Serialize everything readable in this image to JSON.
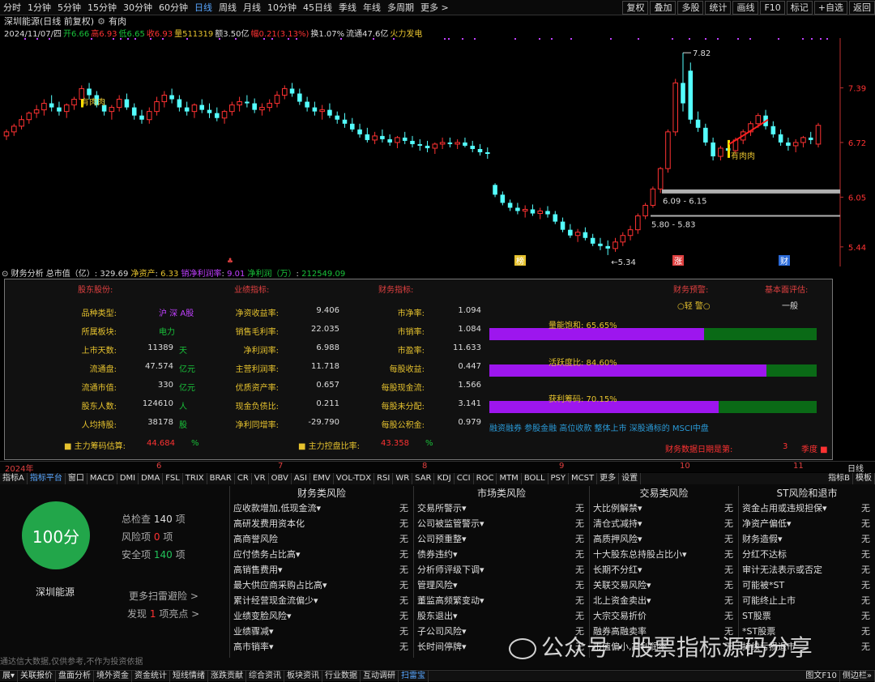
{
  "toolbar": {
    "periods": [
      "分时",
      "1分钟",
      "5分钟",
      "15分钟",
      "30分钟",
      "60分钟",
      "日线",
      "周线",
      "月线",
      "10分钟",
      "45日线",
      "季线",
      "年线",
      "多周期",
      "更多 >"
    ],
    "active_period": "日线",
    "right_buttons": [
      "复权",
      "叠加",
      "多股",
      "统计",
      "画线",
      "F10",
      "标记",
      "+自选",
      "返回"
    ]
  },
  "title": {
    "name": "深圳能源(日线 前复权)",
    "indicator": "有肉"
  },
  "quote": {
    "date": "2024/11/07/四",
    "open": "开6.66",
    "high": "高6.93",
    "low": "低6.65",
    "close": "收6.93",
    "volume": "量511319",
    "amount": "额3.50亿",
    "change": "幅0.21(3.13%)",
    "turnover": "换1.07%",
    "float": "流通47.6亿",
    "sector": "火力发电"
  },
  "chart": {
    "price_labels": [
      "7.39",
      "6.72",
      "6.05",
      "5.44"
    ],
    "annotations": {
      "high": "7.82",
      "low": "5.34",
      "range1": "6.09 - 6.15",
      "range2": "5.80 - 5.83",
      "youroulabel": "有肉肉",
      "markers": [
        "榜",
        "涨",
        "财"
      ]
    },
    "colors": {
      "up": "#ff3232",
      "down": "#54ffff",
      "text": "#e6c22e"
    }
  },
  "candles": [
    [
      6.8,
      6.88,
      6.75,
      6.85
    ],
    [
      6.85,
      6.95,
      6.8,
      6.92
    ],
    [
      6.92,
      7.05,
      6.88,
      7.0
    ],
    [
      7.0,
      7.1,
      6.95,
      7.08
    ],
    [
      7.08,
      7.18,
      7.02,
      7.12
    ],
    [
      7.12,
      7.25,
      7.05,
      7.2
    ],
    [
      7.2,
      7.3,
      7.1,
      7.15
    ],
    [
      7.15,
      7.22,
      7.05,
      7.1
    ],
    [
      7.1,
      7.2,
      7.02,
      7.18
    ],
    [
      7.18,
      7.28,
      7.12,
      7.25
    ],
    [
      7.25,
      7.42,
      7.2,
      7.38
    ],
    [
      7.38,
      7.45,
      7.25,
      7.3
    ],
    [
      7.3,
      7.35,
      7.15,
      7.18
    ],
    [
      7.18,
      7.25,
      7.05,
      7.1
    ],
    [
      7.1,
      7.18,
      7.0,
      7.15
    ],
    [
      7.15,
      7.3,
      7.1,
      7.25
    ],
    [
      7.25,
      7.32,
      7.12,
      7.15
    ],
    [
      7.15,
      7.2,
      7.0,
      7.05
    ],
    [
      7.05,
      7.12,
      6.95,
      7.0
    ],
    [
      7.0,
      7.15,
      6.95,
      7.1
    ],
    [
      7.1,
      7.28,
      7.05,
      7.22
    ],
    [
      7.22,
      7.35,
      7.15,
      7.3
    ],
    [
      7.3,
      7.38,
      7.2,
      7.25
    ],
    [
      7.25,
      7.3,
      7.1,
      7.15
    ],
    [
      7.15,
      7.22,
      7.05,
      7.1
    ],
    [
      7.1,
      7.2,
      7.02,
      7.18
    ],
    [
      7.18,
      7.25,
      7.08,
      7.12
    ],
    [
      7.12,
      7.2,
      7.02,
      7.08
    ],
    [
      7.08,
      7.15,
      6.98,
      7.02
    ],
    [
      7.02,
      7.12,
      6.95,
      7.1
    ],
    [
      7.1,
      7.22,
      7.05,
      7.18
    ],
    [
      7.18,
      7.28,
      7.1,
      7.22
    ],
    [
      7.22,
      7.3,
      7.15,
      7.2
    ],
    [
      7.2,
      7.26,
      7.08,
      7.12
    ],
    [
      7.12,
      7.2,
      7.05,
      7.15
    ],
    [
      7.15,
      7.25,
      7.1,
      7.2
    ],
    [
      7.2,
      7.35,
      7.15,
      7.3
    ],
    [
      7.3,
      7.42,
      7.25,
      7.38
    ],
    [
      7.38,
      7.45,
      7.28,
      7.32
    ],
    [
      7.32,
      7.38,
      7.18,
      7.22
    ],
    [
      7.22,
      7.28,
      7.1,
      7.15
    ],
    [
      7.15,
      7.22,
      7.05,
      7.1
    ],
    [
      7.1,
      7.18,
      7.0,
      7.12
    ],
    [
      7.12,
      7.2,
      7.02,
      7.05
    ],
    [
      7.05,
      7.1,
      6.95,
      7.0
    ],
    [
      7.0,
      7.08,
      6.9,
      6.95
    ],
    [
      6.95,
      7.02,
      6.85,
      6.88
    ],
    [
      6.88,
      6.95,
      6.78,
      6.82
    ],
    [
      6.82,
      6.9,
      6.72,
      6.75
    ],
    [
      6.75,
      6.85,
      6.7,
      6.8
    ],
    [
      6.8,
      6.88,
      6.72,
      6.76
    ],
    [
      6.76,
      6.82,
      6.68,
      6.72
    ],
    [
      6.72,
      6.8,
      6.65,
      6.78
    ],
    [
      6.78,
      6.85,
      6.7,
      6.74
    ],
    [
      6.74,
      6.8,
      6.66,
      6.7
    ],
    [
      6.7,
      6.76,
      6.62,
      6.68
    ],
    [
      6.68,
      6.74,
      6.6,
      6.65
    ],
    [
      6.65,
      6.72,
      6.58,
      6.7
    ],
    [
      6.7,
      6.78,
      6.64,
      6.72
    ],
    [
      6.72,
      6.78,
      6.66,
      6.7
    ],
    [
      6.7,
      6.76,
      6.64,
      6.72
    ],
    [
      6.72,
      6.78,
      6.66,
      6.68
    ],
    [
      6.68,
      6.74,
      6.6,
      6.64
    ],
    [
      6.64,
      6.7,
      6.56,
      6.6
    ],
    [
      6.6,
      6.66,
      6.52,
      6.58
    ],
    [
      6.2,
      6.22,
      6.05,
      6.08
    ],
    [
      6.08,
      6.12,
      5.95,
      5.98
    ],
    [
      5.98,
      6.02,
      5.88,
      5.92
    ],
    [
      5.92,
      5.98,
      5.84,
      5.88
    ],
    [
      5.88,
      5.95,
      5.8,
      5.9
    ],
    [
      5.9,
      5.96,
      5.82,
      5.85
    ],
    [
      5.85,
      5.92,
      5.78,
      5.88
    ],
    [
      5.88,
      5.94,
      5.8,
      5.84
    ],
    [
      5.84,
      5.88,
      5.72,
      5.75
    ],
    [
      5.75,
      5.8,
      5.62,
      5.65
    ],
    [
      5.65,
      5.72,
      5.55,
      5.58
    ],
    [
      5.58,
      5.66,
      5.5,
      5.62
    ],
    [
      5.62,
      5.68,
      5.52,
      5.55
    ],
    [
      5.55,
      5.6,
      5.45,
      5.48
    ],
    [
      5.48,
      5.55,
      5.4,
      5.45
    ],
    [
      5.45,
      5.52,
      5.34,
      5.42
    ],
    [
      5.42,
      5.55,
      5.38,
      5.5
    ],
    [
      5.5,
      5.62,
      5.45,
      5.58
    ],
    [
      5.58,
      5.7,
      5.52,
      5.65
    ],
    [
      5.65,
      5.85,
      5.6,
      5.82
    ],
    [
      5.82,
      5.98,
      5.78,
      5.95
    ],
    [
      5.95,
      6.18,
      5.92,
      6.15
    ],
    [
      6.15,
      6.42,
      6.1,
      6.4
    ],
    [
      6.4,
      6.88,
      6.35,
      6.85
    ],
    [
      6.85,
      7.5,
      6.8,
      7.45
    ],
    [
      7.45,
      7.82,
      7.1,
      7.2
    ],
    [
      7.6,
      7.7,
      6.95,
      7.0
    ],
    [
      7.0,
      7.1,
      6.85,
      6.9
    ],
    [
      6.9,
      6.95,
      6.68,
      6.72
    ],
    [
      6.72,
      6.78,
      6.5,
      6.55
    ],
    [
      6.55,
      6.68,
      6.5,
      6.65
    ],
    [
      6.65,
      6.72,
      6.58,
      6.62
    ],
    [
      6.62,
      6.78,
      6.58,
      6.75
    ],
    [
      6.75,
      6.88,
      6.7,
      6.85
    ],
    [
      6.85,
      6.98,
      6.8,
      6.95
    ],
    [
      6.95,
      7.08,
      6.9,
      7.05
    ],
    [
      7.05,
      7.12,
      6.88,
      6.92
    ],
    [
      6.92,
      6.98,
      6.78,
      6.82
    ],
    [
      6.82,
      6.88,
      6.68,
      6.72
    ],
    [
      6.72,
      6.78,
      6.62,
      6.68
    ],
    [
      6.68,
      6.76,
      6.6,
      6.72
    ],
    [
      6.72,
      6.8,
      6.66,
      6.78
    ],
    [
      6.78,
      6.85,
      6.7,
      6.75
    ],
    [
      6.7,
      6.96,
      6.66,
      6.93
    ]
  ],
  "fin": {
    "header": {
      "label": "财务分析",
      "total_label": "总市值（亿）",
      "total_value": "329.69",
      "net_asset_label": "净资产",
      "net_asset_value": "6.33",
      "margin_label": "销净利润率",
      "margin_value": "9.01",
      "profit_label": "净利润（万）",
      "profit_value": "212549.09"
    },
    "headings": {
      "shareholder": "股东股份:",
      "performance": "业绩指标:",
      "financial": "财务指标:",
      "warning": "财务预警:",
      "fundamental": "基本面评估:"
    },
    "warning_level": "○轻 警○",
    "fundamental_value": "一般",
    "col1": [
      {
        "l": "品种类型:",
        "v": "",
        "u": "沪 深 A股"
      },
      {
        "l": "所属板块:",
        "v": "",
        "u": "电力"
      },
      {
        "l": "上市天数:",
        "v": "11389",
        "u": "天"
      },
      {
        "l": "流通盘:",
        "v": "47.574",
        "u": "亿元"
      },
      {
        "l": "流通市值:",
        "v": "330",
        "u": "亿元"
      },
      {
        "l": "股东人数:",
        "v": "124610",
        "u": "人"
      },
      {
        "l": "人均持股:",
        "v": "38178",
        "u": "股"
      }
    ],
    "col2": [
      {
        "l": "净资收益率:",
        "v": "9.406"
      },
      {
        "l": "销售毛利率:",
        "v": "22.035"
      },
      {
        "l": "净利润率:",
        "v": "6.988"
      },
      {
        "l": "主营利润率:",
        "v": "11.718"
      },
      {
        "l": "优质资产率:",
        "v": "0.657"
      },
      {
        "l": "现金负债比:",
        "v": "0.211"
      },
      {
        "l": "净利同增率:",
        "v": "-29.790"
      }
    ],
    "col3": [
      {
        "l": "市净率:",
        "v": "1.094"
      },
      {
        "l": "市销率:",
        "v": "1.084"
      },
      {
        "l": "市盈率:",
        "v": "11.633"
      },
      {
        "l": "每股收益:",
        "v": "0.447"
      },
      {
        "l": "每股现金流:",
        "v": "1.566"
      },
      {
        "l": "每股未分配:",
        "v": "3.141"
      },
      {
        "l": "每股公积金:",
        "v": "0.979"
      }
    ],
    "bars": [
      {
        "label": "量能饱和: 65.65%",
        "fraction": 0.6565
      },
      {
        "label": "活跃度比: 84.60%",
        "fraction": 0.846
      },
      {
        "label": "获利筹码: 70.15%",
        "fraction": 0.7015
      }
    ],
    "tags": "融资融券 参股金融 高位收款 整体上市 深股通标的 MSCI中盘",
    "chip_label": "主力筹码估算:",
    "chip_value": "44.684",
    "chip_unit": "%",
    "control_label": "主力控盘比率:",
    "control_value": "43.358",
    "control_unit": "%",
    "report_label": "财务数据日期是第:",
    "report_value": "3",
    "report_unit": "季度"
  },
  "datebar": {
    "year": "2024年",
    "months": [
      "6",
      "7",
      "8",
      "9",
      "10",
      "11"
    ],
    "period": "日线"
  },
  "indtabs": {
    "left": "指标A",
    "items": [
      "指标平台",
      "窗口",
      "MACD",
      "DMI",
      "DMA",
      "FSL",
      "TRIX",
      "BRAR",
      "CR",
      "VR",
      "OBV",
      "ASI",
      "EMV",
      "VOL-TDX",
      "RSI",
      "WR",
      "SAR",
      "KDJ",
      "CCI",
      "ROC",
      "MTM",
      "BOLL",
      "PSY",
      "MCST",
      "更多",
      "设置"
    ],
    "right": [
      "指标B",
      "模板"
    ]
  },
  "scan": {
    "score": "100分",
    "stock": "深圳能源",
    "total_label": "总检查",
    "total_value": "140",
    "total_unit": "项",
    "risk_label": "风险项",
    "risk_value": "0",
    "risk_unit": "项",
    "safe_label": "安全项",
    "safe_value": "140",
    "safe_unit": "项",
    "more": "更多扫雷避险 >",
    "found": "发现",
    "found_count": "1",
    "found_unit": "项亮点 >",
    "disclaimer": "通达信大数据,仅供参考,不作为投资依据",
    "columns": [
      {
        "title": "财务类风险",
        "rows": [
          "应收款增加,低现金流▾",
          "高研发费用资本化",
          "高商誉风险",
          "应付债务占比高▾",
          "高销售费用▾",
          "最大供应商采购占比高▾",
          "累计经营现金流偏少▾",
          "业绩变脸风险▾",
          "业绩骤减▾",
          "高市销率▾"
        ]
      },
      {
        "title": "市场类风险",
        "rows": [
          "交易所警示▾",
          "公司被监管警示▾",
          "公司预重整▾",
          "债券违约▾",
          "分析师评级下调▾",
          "管理风险▾",
          "董监高频繁变动▾",
          "股东退出▾",
          "子公司风险▾",
          "长时间停牌▾"
        ]
      },
      {
        "title": "交易类风险",
        "rows": [
          "大比例解禁▾",
          "清仓式减持▾",
          "高质押风险▾",
          "十大股东总持股占比小▾",
          "长期不分红▾",
          "关联交易风险▾",
          "北上资金卖出▾",
          "大宗交易折价",
          "融券高融卖率",
          "市值偏小,高利润率"
        ]
      },
      {
        "title": "ST风险和退市",
        "rows": [
          "资金占用或违规担保▾",
          "净资产偏低▾",
          "财务造假▾",
          "分红不达标",
          "审计无法表示或否定",
          "可能被*ST",
          "可能终止上市",
          "ST股票",
          "*ST股票",
          "持续亏损退市"
        ]
      }
    ],
    "status": "无"
  },
  "bottom": {
    "items": [
      "展▾",
      "关联报价",
      "盘面分析",
      "境外资金",
      "资金统计",
      "短线情绪",
      "涨跌贡献",
      "综合资讯",
      "板块资讯",
      "行业数据",
      "互动调研",
      "扫雷宝"
    ],
    "active": "扫雷宝",
    "right": [
      "图文F10",
      "侧边栏»"
    ]
  },
  "watermark": "公众号 · 股票指标源码分享"
}
